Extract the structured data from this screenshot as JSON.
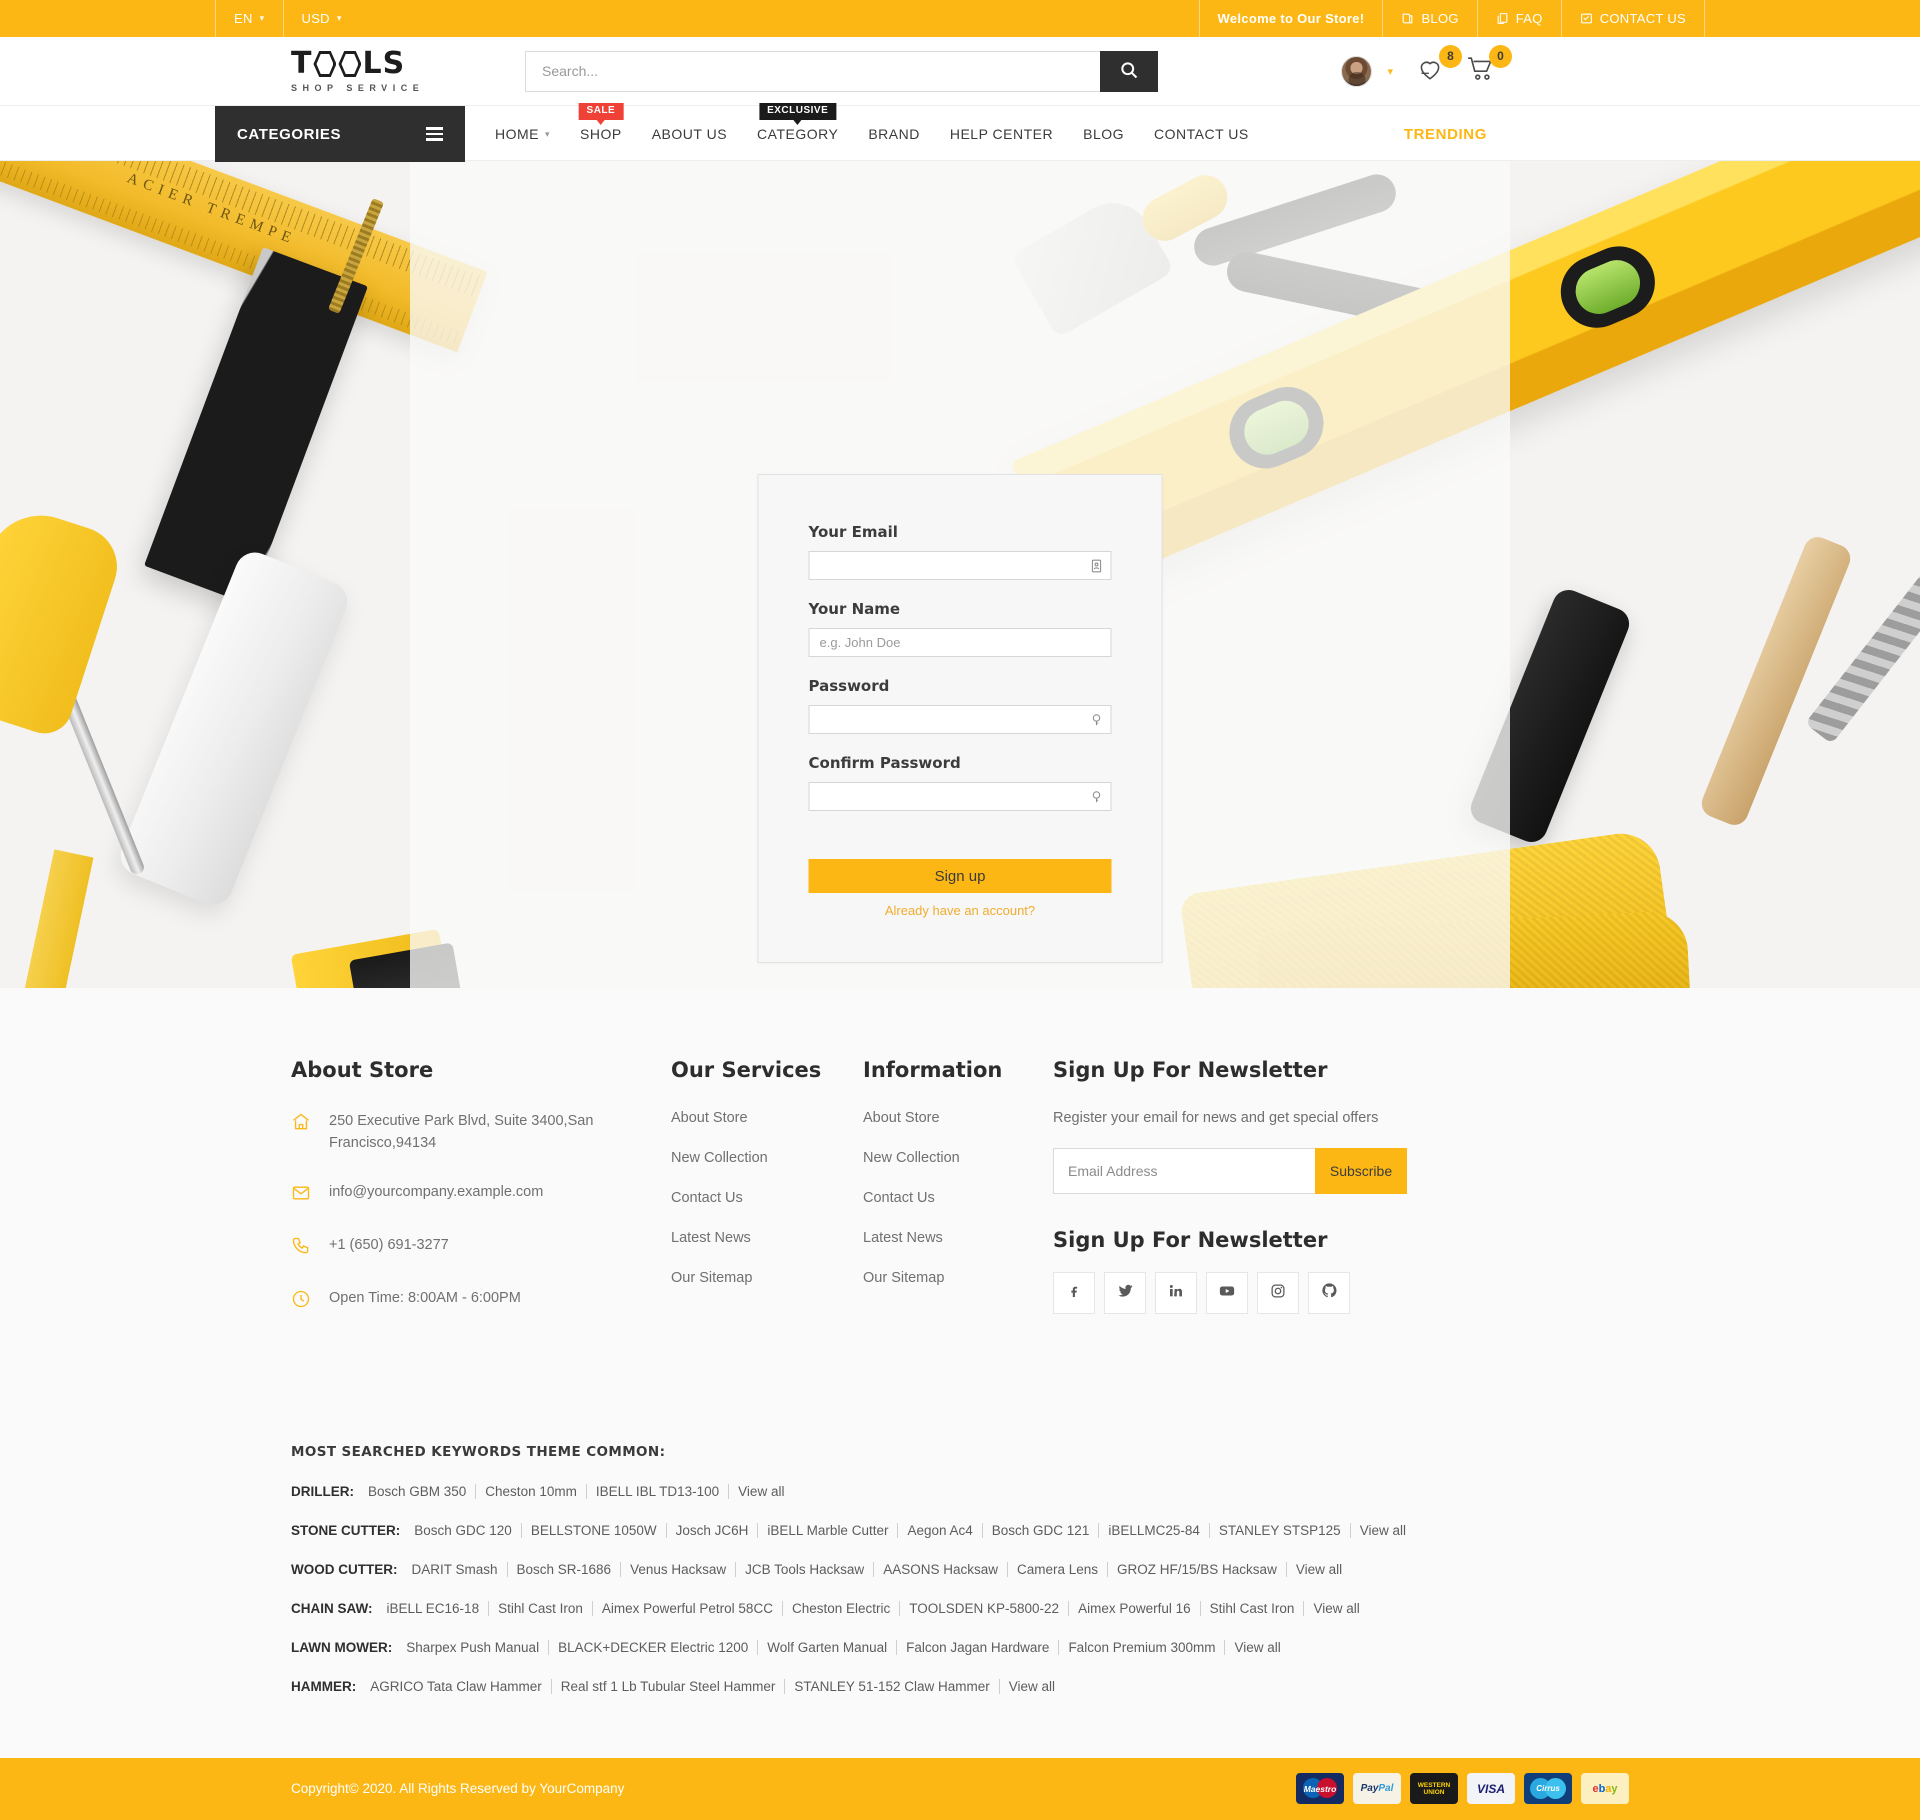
{
  "topbar": {
    "language": "EN",
    "currency": "USD",
    "welcome": "Welcome to Our Store!",
    "blog": "BLOG",
    "faq": "FAQ",
    "contact": "CONTACT US"
  },
  "header": {
    "logo_main_a": "T",
    "logo_main_b": "LS",
    "logo_sub": "SHOP SERVICE",
    "search_placeholder": "Search...",
    "search_value": "",
    "wishlist_count": "8",
    "cart_count": "0"
  },
  "nav": {
    "categories_label": "CATEGORIES",
    "items": [
      {
        "label": "HOME",
        "caret": true,
        "tag": ""
      },
      {
        "label": "SHOP",
        "caret": false,
        "tag": "SALE"
      },
      {
        "label": "ABOUT US",
        "caret": false,
        "tag": ""
      },
      {
        "label": "CATEGORY",
        "caret": false,
        "tag": "EXCLUSIVE"
      },
      {
        "label": "BRAND",
        "caret": false,
        "tag": ""
      },
      {
        "label": "HELP CENTER",
        "caret": false,
        "tag": ""
      },
      {
        "label": "BLOG",
        "caret": false,
        "tag": ""
      },
      {
        "label": "CONTACT US",
        "caret": false,
        "tag": ""
      }
    ],
    "trending": "TRENDING"
  },
  "signup": {
    "email_label": "Your Email",
    "email_value": "",
    "email_placeholder": "",
    "name_label": "Your Name",
    "name_value": "",
    "name_placeholder": "e.g. John Doe",
    "password_label": "Password",
    "password_value": "",
    "password_placeholder": "",
    "confirm_label": "Confirm Password",
    "confirm_value": "",
    "confirm_placeholder": "",
    "submit_label": "Sign up",
    "already_label": "Already have an account?"
  },
  "footer": {
    "about": {
      "title": "About Store",
      "address": "250 Executive Park Blvd, Suite 3400,San Francisco,94134",
      "email": "info@yourcompany.example.com",
      "phone": "+1 (650) 691-3277",
      "hours": "Open Time: 8:00AM - 6:00PM"
    },
    "services": {
      "title": "Our Services",
      "links": [
        "About Store",
        "New Collection",
        "Contact Us",
        "Latest News",
        "Our Sitemap"
      ]
    },
    "information": {
      "title": "Information",
      "links": [
        "About Store",
        "New Collection",
        "Contact Us",
        "Latest News",
        "Our Sitemap"
      ]
    },
    "newsletter": {
      "title": "Sign Up For Newsletter",
      "description": "Register your email for news and get special offers",
      "input_placeholder": "Email Address",
      "input_value": "",
      "button": "Subscribe",
      "social_title": "Sign Up For Newsletter",
      "socials": [
        "facebook",
        "twitter",
        "linkedin",
        "youtube",
        "instagram",
        "github"
      ]
    }
  },
  "keywords": {
    "title": "MOST SEARCHED KEYWORDS THEME COMMON:",
    "rows": [
      {
        "category": "DRILLER:",
        "items": [
          "Bosch GBM 350",
          "Cheston 10mm",
          "IBELL IBL TD13-100",
          "View all"
        ]
      },
      {
        "category": "STONE CUTTER:",
        "items": [
          "Bosch GDC 120",
          "BELLSTONE 1050W",
          "Josch JC6H",
          "iBELL Marble Cutter",
          "Aegon Ac4",
          "Bosch GDC 121",
          "iBELLMC25-84",
          "STANLEY STSP125",
          "View all"
        ]
      },
      {
        "category": "WOOD CUTTER:",
        "items": [
          "DARIT Smash",
          "Bosch SR-1686",
          "Venus Hacksaw",
          "JCB Tools Hacksaw",
          "AASONS Hacksaw",
          "Camera Lens",
          "GROZ HF/15/BS Hacksaw",
          "View all"
        ]
      },
      {
        "category": "CHAIN SAW:",
        "items": [
          "iBELL EC16-18",
          "Stihl Cast Iron",
          "Aimex Powerful Petrol 58CC",
          "Cheston Electric",
          "TOOLSDEN KP-5800-22",
          "Aimex Powerful 16",
          "Stihl Cast Iron",
          "View all"
        ]
      },
      {
        "category": "LAWN MOWER:",
        "items": [
          "Sharpex Push Manual",
          "BLACK+DECKER Electric 1200",
          "Wolf Garten Manual",
          "Falcon Jagan Hardware",
          "Falcon Premium 300mm",
          "View all"
        ]
      },
      {
        "category": "HAMMER:",
        "items": [
          "AGRICO Tata Claw Hammer",
          "Real stf 1 Lb Tubular Steel Hammer",
          "STANLEY 51-152 Claw Hammer",
          "View all"
        ]
      }
    ]
  },
  "bottombar": {
    "copyright": "Copyright© 2020. All Rights Reserved by YourCompany",
    "payments": [
      "Maestro",
      "PayPal",
      "WESTERN UNION",
      "VISA",
      "Cirrus",
      "ebay"
    ]
  },
  "colors": {
    "brand_yellow": "#fcb714",
    "dark": "#2f2f2f",
    "sale_red": "#ef4136"
  }
}
